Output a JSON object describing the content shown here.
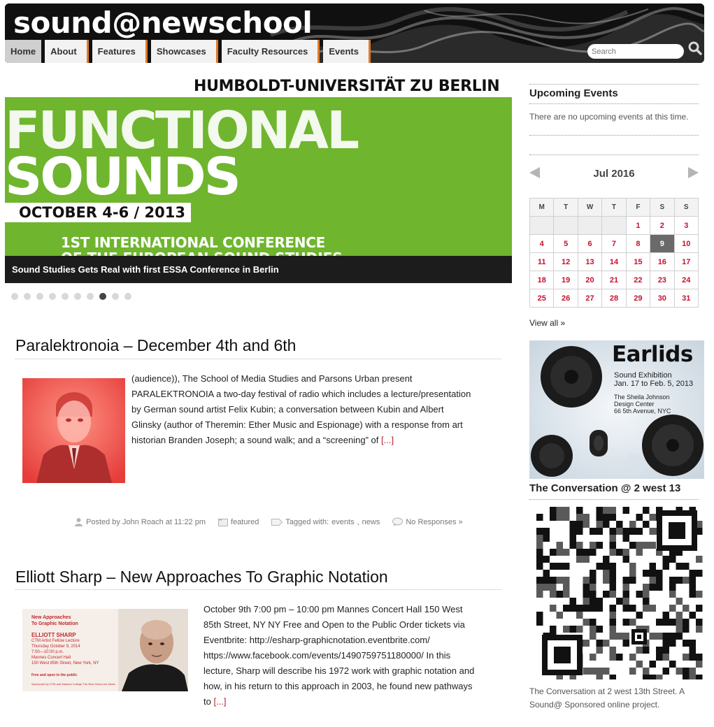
{
  "site": {
    "title": "sound@newschool"
  },
  "nav": [
    {
      "label": "Home"
    },
    {
      "label": "About"
    },
    {
      "label": "Features"
    },
    {
      "label": "Showcases"
    },
    {
      "label": "Faculty Resources"
    },
    {
      "label": "Events"
    }
  ],
  "search": {
    "placeholder": "Search"
  },
  "slider": {
    "image_text": {
      "university": "HUMBOLDT-UNIVERSITÄT ZU BERLIN",
      "headline_1": "FUNCTIONAL",
      "headline_2": "SOUNDS",
      "dates": "OCTOBER 4-6 / 2013",
      "conference_line_1": "1ST INTERNATIONAL CONFERENCE",
      "conference_line_2": "OF THE EUROPEAN SOUND STUDIES"
    },
    "caption": "Sound Studies Gets Real with first ESSA Conference in Berlin",
    "dot_count": 10,
    "active_dot": 7
  },
  "posts": [
    {
      "title": "Paralektronoia – December 4th and 6th",
      "excerpt_lines": [
        "(audience)), The School of Media Studies and Parsons Urban present",
        "PARALEKTRONOIA a two-day festival of radio which includes a lecture/presentation",
        "by German sound artist Felix Kubin; a conversation between Kubin and Albert",
        "Glinsky (author of Theremin: Ether Music and Espionage) with a response from art",
        "historian Branden Joseph; a sound walk; and a “screening” of"
      ],
      "more": "[...]",
      "meta": {
        "posted_by": "Posted by John Roach at 11:22 pm",
        "category": "featured",
        "tagged_prefix": "Tagged with:",
        "tag_1": "events",
        "tag_2": "news",
        "responses": "No Responses »"
      }
    },
    {
      "title": "Elliott Sharp – New Approaches To Graphic Notation",
      "excerpt_lines": [
        "October 9th 7:00 pm – 10:00 pm Mannes Concert Hall 150 West",
        "85th Street, NY NY Free and Open to the Public Order tickets via",
        "Eventbrite: http://esharp-graphicnotation.eventbrite.com/",
        "https://www.facebook.com/events/1490759751180000/ In this",
        "lecture, Sharp will describe his 1972 work with graphic notation and",
        "how, in his return to this approach in 2003, he found new pathways",
        "to"
      ],
      "more": "[...]",
      "poster": {
        "line_1": "New Approaches",
        "line_2": "To Graphic Notation",
        "name": "ELLIOTT SHARP",
        "role": "CTM Artist Fellow Lecture",
        "date": "Thursday October 9, 2014",
        "time": "7:00—10:00 p.m.",
        "venue": "Mannes Concert Hall",
        "address": "150 West 85th Street, New York, NY",
        "free": "Free and open to the public",
        "sponsor": "Sponsored by CTM and Mannes College The New School for Music"
      }
    }
  ],
  "sidebar": {
    "upcoming": {
      "title": "Upcoming Events",
      "empty_text": "There are no upcoming events at this time."
    },
    "calendar": {
      "month": "Jul 2016",
      "weekdays": [
        "M",
        "T",
        "W",
        "T",
        "F",
        "S",
        "S"
      ],
      "weeks": [
        [
          "",
          "",
          "",
          "",
          "1",
          "2",
          "3"
        ],
        [
          "4",
          "5",
          "6",
          "7",
          "8",
          "9",
          "10"
        ],
        [
          "11",
          "12",
          "13",
          "14",
          "15",
          "16",
          "17"
        ],
        [
          "18",
          "19",
          "20",
          "21",
          "22",
          "23",
          "24"
        ],
        [
          "25",
          "26",
          "27",
          "28",
          "29",
          "30",
          "31"
        ]
      ],
      "today": "9",
      "view_all": "View all »"
    },
    "earlids": {
      "title": "Earlids",
      "line_1": "Sound Exhibition",
      "line_2": "Jan. 17 to Feb. 5, 2013",
      "line_3": "The Sheila Johnson",
      "line_4": "Design Center",
      "line_5": "66 5th Avenue, NYC"
    },
    "conversation": {
      "title": "The Conversation @ 2 west 13",
      "description": "The Conversation at 2 west 13th Street. A Sound@ Sponsored online project."
    }
  },
  "colors": {
    "accent_orange": "#e07a2a",
    "link_red": "#b0242a",
    "calendar_red": "#c8102e",
    "slide_green": "#6fb52e"
  }
}
